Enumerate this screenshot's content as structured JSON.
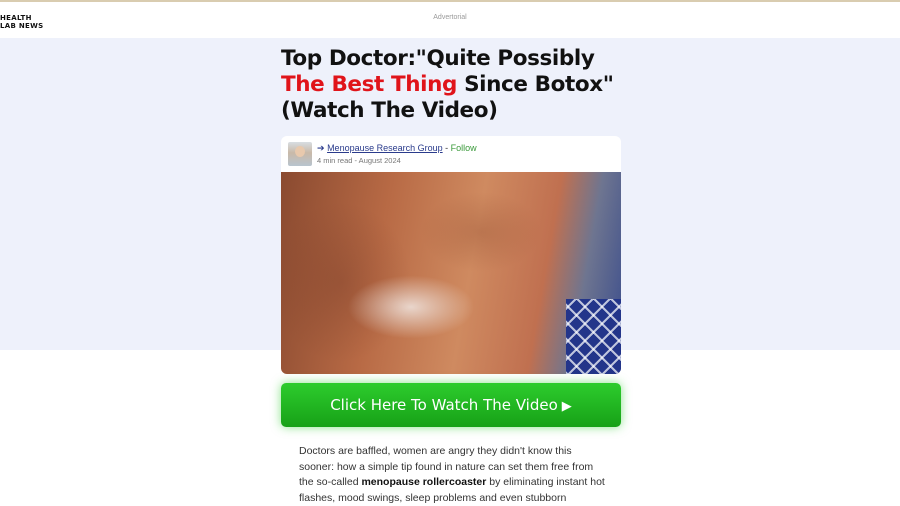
{
  "header": {
    "logo_line1": "HEALTH",
    "logo_line2": "LAB NEWS",
    "advertorial": "Advertorial"
  },
  "article": {
    "headline_part1": "Top Doctor:\"Quite Possibly ",
    "headline_red": "The Best Thing",
    "headline_part2": " Since Botox\" (Watch The Video)",
    "author_arrow": "➔",
    "author_group": "Menopause Research Group",
    "author_sep": " - ",
    "follow_label": "Follow",
    "meta": "4 min read - August 2024",
    "cta_label": "Click Here To Watch The Video",
    "cta_icon": "▶",
    "body_part1": "Doctors are baffled, women are angry they didn't know this sooner: how a simple tip found in nature can set them free from the so-called ",
    "body_bold": "menopause rollercoaster",
    "body_part2": " by eliminating instant hot flashes, mood swings, sleep problems and even stubborn"
  },
  "colors": {
    "hero_bg": "#eef1fb",
    "headline_red": "#e0141a",
    "cta_green": "#1fb51f",
    "follow_green": "#3a9a3a",
    "link_blue": "#2a3b8c"
  }
}
